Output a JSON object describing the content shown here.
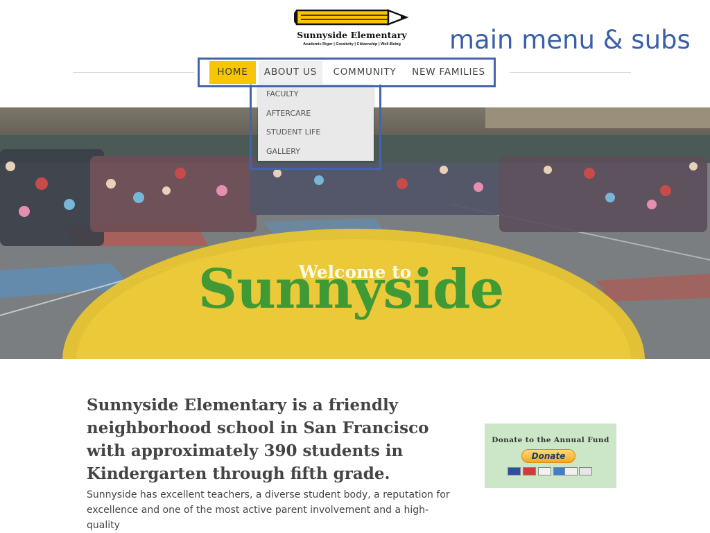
{
  "header": {
    "school_name": "Sunnyside Elementary",
    "tagline": "Academic Rigor | Creativity | Citizenship | Well-Being",
    "annotation": "main menu & subs"
  },
  "nav": {
    "items": [
      {
        "label": "HOME",
        "active": true
      },
      {
        "label": "ABOUT US",
        "hover": true
      },
      {
        "label": "COMMUNITY"
      },
      {
        "label": "NEW FAMILIES"
      }
    ],
    "submenu": [
      "FACULTY",
      "AFTERCARE",
      "STUDENT LIFE",
      "GALLERY"
    ]
  },
  "hero": {
    "welcome": "Welcome to",
    "title": "Sunnyside"
  },
  "content": {
    "intro": "Sunnyside Elementary is a friendly neighborhood school in San Francisco with approximately 390 students in Kindergarten through fifth grade.",
    "body": "Sunnyside has excellent teachers, a diverse student body, a reputation for excellence and one of the most active parent involvement and a high-quality"
  },
  "donate": {
    "title": "Donate to the Annual Fund",
    "button": "Donate"
  },
  "colors": {
    "accent_yellow": "#f7c600",
    "brand_green": "#3f9a36",
    "annotation_blue": "#3b5fa8",
    "donate_bg": "#cce6c8"
  },
  "icons": [
    "pencil-logo-icon",
    "credit-card-icons"
  ]
}
